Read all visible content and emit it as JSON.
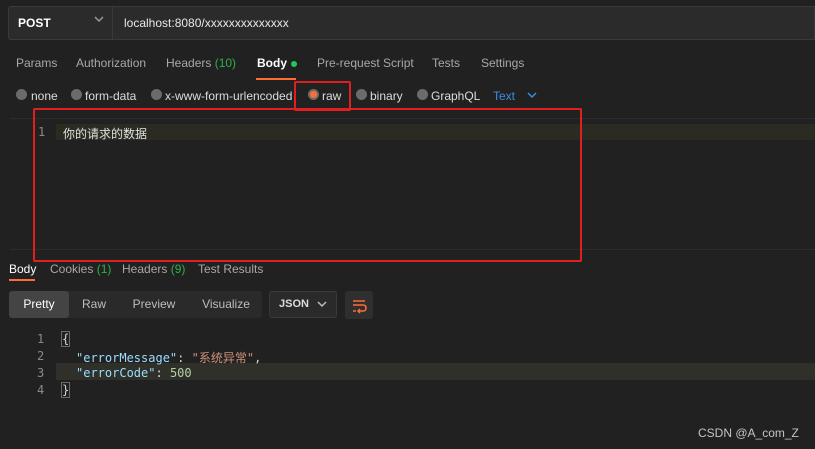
{
  "request": {
    "method": "POST",
    "url": "localhost:8080/xxxxxxxxxxxxxx"
  },
  "request_tabs": {
    "params": "Params",
    "authorization": "Authorization",
    "headers": "Headers",
    "headers_count": "(10)",
    "body": "Body",
    "pre_request": "Pre-request Script",
    "tests": "Tests",
    "settings": "Settings"
  },
  "body_types": {
    "none": "none",
    "form_data": "form-data",
    "urlencoded": "x-www-form-urlencoded",
    "raw": "raw",
    "binary": "binary",
    "graphql": "GraphQL",
    "selected": "raw",
    "format": "Text"
  },
  "editor": {
    "line1_num": "1",
    "line1_text": "你的请求的数据"
  },
  "response_tabs": {
    "body": "Body",
    "cookies": "Cookies",
    "cookies_count": "(1)",
    "headers": "Headers",
    "headers_count": "(9)",
    "test_results": "Test Results"
  },
  "view": {
    "pretty": "Pretty",
    "raw": "Raw",
    "preview": "Preview",
    "visualize": "Visualize",
    "format": "JSON"
  },
  "response": {
    "line_nums": [
      "1",
      "2",
      "3",
      "4"
    ],
    "open": "{",
    "key1": "\"errorMessage\"",
    "val1": "\"系统异常\"",
    "key2": "\"errorCode\"",
    "val2": "500",
    "close": "}",
    "colon": ": ",
    "comma": ","
  },
  "colors": {
    "accent": "#ff6c37",
    "highlight_box": "#e02020",
    "count_green": "#2bb34a",
    "link_blue": "#3d8be3"
  },
  "watermark": "CSDN @A_com_Z"
}
